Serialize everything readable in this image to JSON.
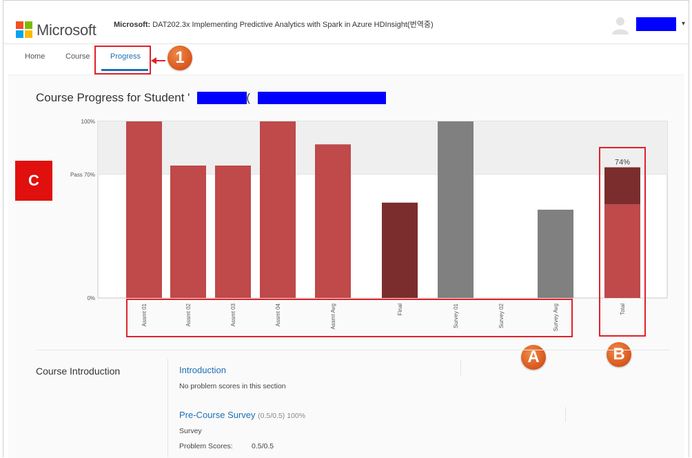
{
  "header": {
    "brand": "Microsoft",
    "course_prefix": "Microsoft:",
    "course_name": "DAT202.3x Implementing Predictive Analytics with Spark in Azure HDInsight(번역중)",
    "user_caret": "▾"
  },
  "nav": {
    "items": [
      {
        "label": "Home"
      },
      {
        "label": "Course"
      },
      {
        "label": "Progress"
      }
    ]
  },
  "page": {
    "title_prefix": "Course Progress for Student '",
    "title_mid": "' (",
    "title_end": ")"
  },
  "callouts": {
    "one": "1",
    "a": "A",
    "b": "B",
    "c": "C"
  },
  "colors": {
    "bar_red": "#c0494a",
    "bar_dark": "#7b2d2d",
    "bar_gray": "#808080",
    "accent": "#1d6fb5",
    "annotation": "#e0202a"
  },
  "chart_data": {
    "type": "bar",
    "y_ticks": [
      "100%",
      "Pass 70%",
      "0%"
    ],
    "ylim": [
      0,
      100
    ],
    "pass_threshold": 70,
    "categories": [
      "Assmt 01",
      "Assmt 02",
      "Assmt 03",
      "Assmt 04",
      "Assmt Avg",
      "Final",
      "Survey 01",
      "Survey 02",
      "Survey Avg",
      "Total"
    ],
    "values": [
      100,
      75,
      75,
      100,
      87,
      54,
      100,
      0,
      50,
      74
    ],
    "bar_kinds": [
      "red",
      "red",
      "red",
      "red",
      "red",
      "dark",
      "gray",
      "none",
      "gray",
      "stack"
    ],
    "total_stack": {
      "lower": 53,
      "upper": 21
    },
    "data_labels": {
      "Total": "74%"
    }
  },
  "sections": {
    "title": "Course Introduction",
    "items": [
      {
        "title": "Introduction",
        "note": "No problem scores in this section"
      },
      {
        "title": "Pre-Course Survey",
        "score": "(0.5/0.5) 100%",
        "type": "Survey",
        "scores_label": "Problem Scores:",
        "scores_value": "0.5/0.5"
      }
    ]
  }
}
